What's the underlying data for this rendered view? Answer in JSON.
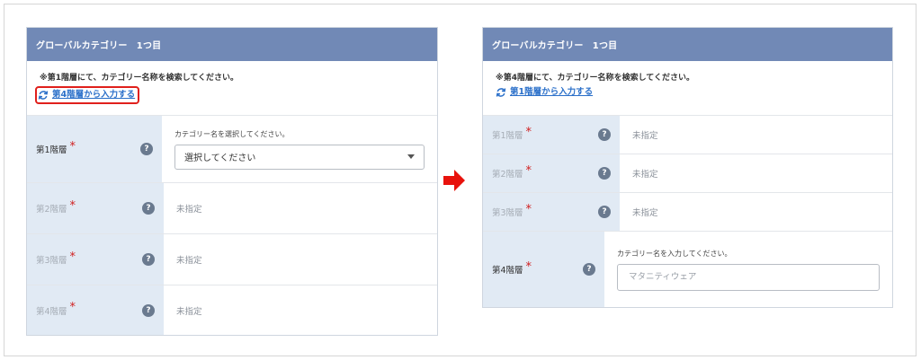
{
  "colors": {
    "header_bg": "#7189b6",
    "label_bg": "#e1eaf4",
    "link": "#2a6fc9",
    "required": "#d02020",
    "highlight_border": "#e0201c",
    "arrow": "#e8120c"
  },
  "left_panel": {
    "title": "グローバルカテゴリー　1つ目",
    "note": "※第1階層にて、カテゴリー名称を検索してください。",
    "switch_link": "第4階層から入力する",
    "switch_icon": "refresh-icon",
    "rows": [
      {
        "label": "第1階層",
        "required": "*",
        "help": "?",
        "caption": "カテゴリー名を選択してください。",
        "select_value": "選択してください"
      },
      {
        "label": "第2階層",
        "required": "*",
        "help": "?",
        "value": "未指定"
      },
      {
        "label": "第3階層",
        "required": "*",
        "help": "?",
        "value": "未指定"
      },
      {
        "label": "第4階層",
        "required": "*",
        "help": "?",
        "value": "未指定"
      }
    ]
  },
  "arrow_icon": "right-arrow-icon",
  "right_panel": {
    "title": "グローバルカテゴリー　1つ目",
    "note": "※第4階層にて、カテゴリー名称を検索してください。",
    "switch_link": "第1階層から入力する",
    "switch_icon": "refresh-icon",
    "rows": [
      {
        "label": "第1階層",
        "required": "*",
        "help": "?",
        "value": "未指定"
      },
      {
        "label": "第2階層",
        "required": "*",
        "help": "?",
        "value": "未指定"
      },
      {
        "label": "第3階層",
        "required": "*",
        "help": "?",
        "value": "未指定"
      },
      {
        "label": "第4階層",
        "required": "*",
        "help": "?",
        "caption": "カテゴリー名を入力してください。",
        "input_placeholder": "マタニティウェア"
      }
    ]
  }
}
